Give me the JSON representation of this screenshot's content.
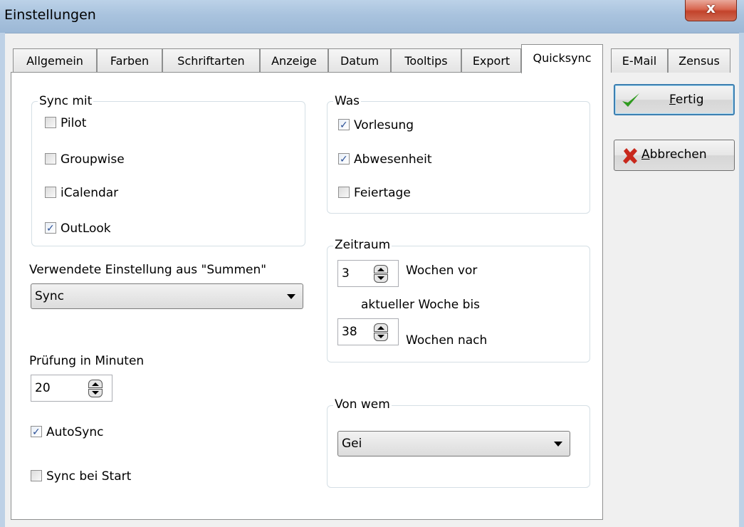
{
  "window": {
    "title": "Einstellungen",
    "close_glyph": "x"
  },
  "tabs": [
    {
      "label": "Allgemein"
    },
    {
      "label": "Farben"
    },
    {
      "label": "Schriftarten"
    },
    {
      "label": "Anzeige"
    },
    {
      "label": "Datum"
    },
    {
      "label": "Tooltips"
    },
    {
      "label": "Export"
    },
    {
      "label": "Quicksync",
      "active": true
    },
    {
      "label": "E-Mail"
    },
    {
      "label": "Zensus"
    }
  ],
  "sync_mit": {
    "title": "Sync mit",
    "items": [
      {
        "label": "Pilot",
        "checked": false
      },
      {
        "label": "Groupwise",
        "checked": false
      },
      {
        "label": "iCalendar",
        "checked": false
      },
      {
        "label": "OutLook",
        "checked": true
      }
    ]
  },
  "was": {
    "title": "Was",
    "items": [
      {
        "label": "Vorlesung",
        "checked": true
      },
      {
        "label": "Abwesenheit",
        "checked": true
      },
      {
        "label": "Feiertage",
        "checked": false
      }
    ]
  },
  "summen": {
    "label": "Verwendete Einstellung aus \"Summen\"",
    "selected": "Sync"
  },
  "pruefung": {
    "label": "Prüfung in Minuten",
    "value": "20"
  },
  "options": [
    {
      "label": "AutoSync",
      "checked": true
    },
    {
      "label": "Sync bei Start",
      "checked": false
    }
  ],
  "zeitraum": {
    "title": "Zeitraum",
    "before_value": "3",
    "before_label": "Wochen vor",
    "middle_label": "aktueller Woche bis",
    "after_value": "38",
    "after_label": "Wochen nach"
  },
  "von_wem": {
    "title": "Von wem",
    "selected": "Gei"
  },
  "buttons": {
    "fertig": {
      "prefix": "",
      "accel": "F",
      "rest": "ertig",
      "icon": "checkmark-icon",
      "icon_color": "#2e9a1e"
    },
    "abbrechen": {
      "prefix": "",
      "accel": "A",
      "rest": "bbrechen",
      "icon": "cross-icon",
      "icon_color": "#c8281c"
    }
  },
  "check_glyph": "✓"
}
